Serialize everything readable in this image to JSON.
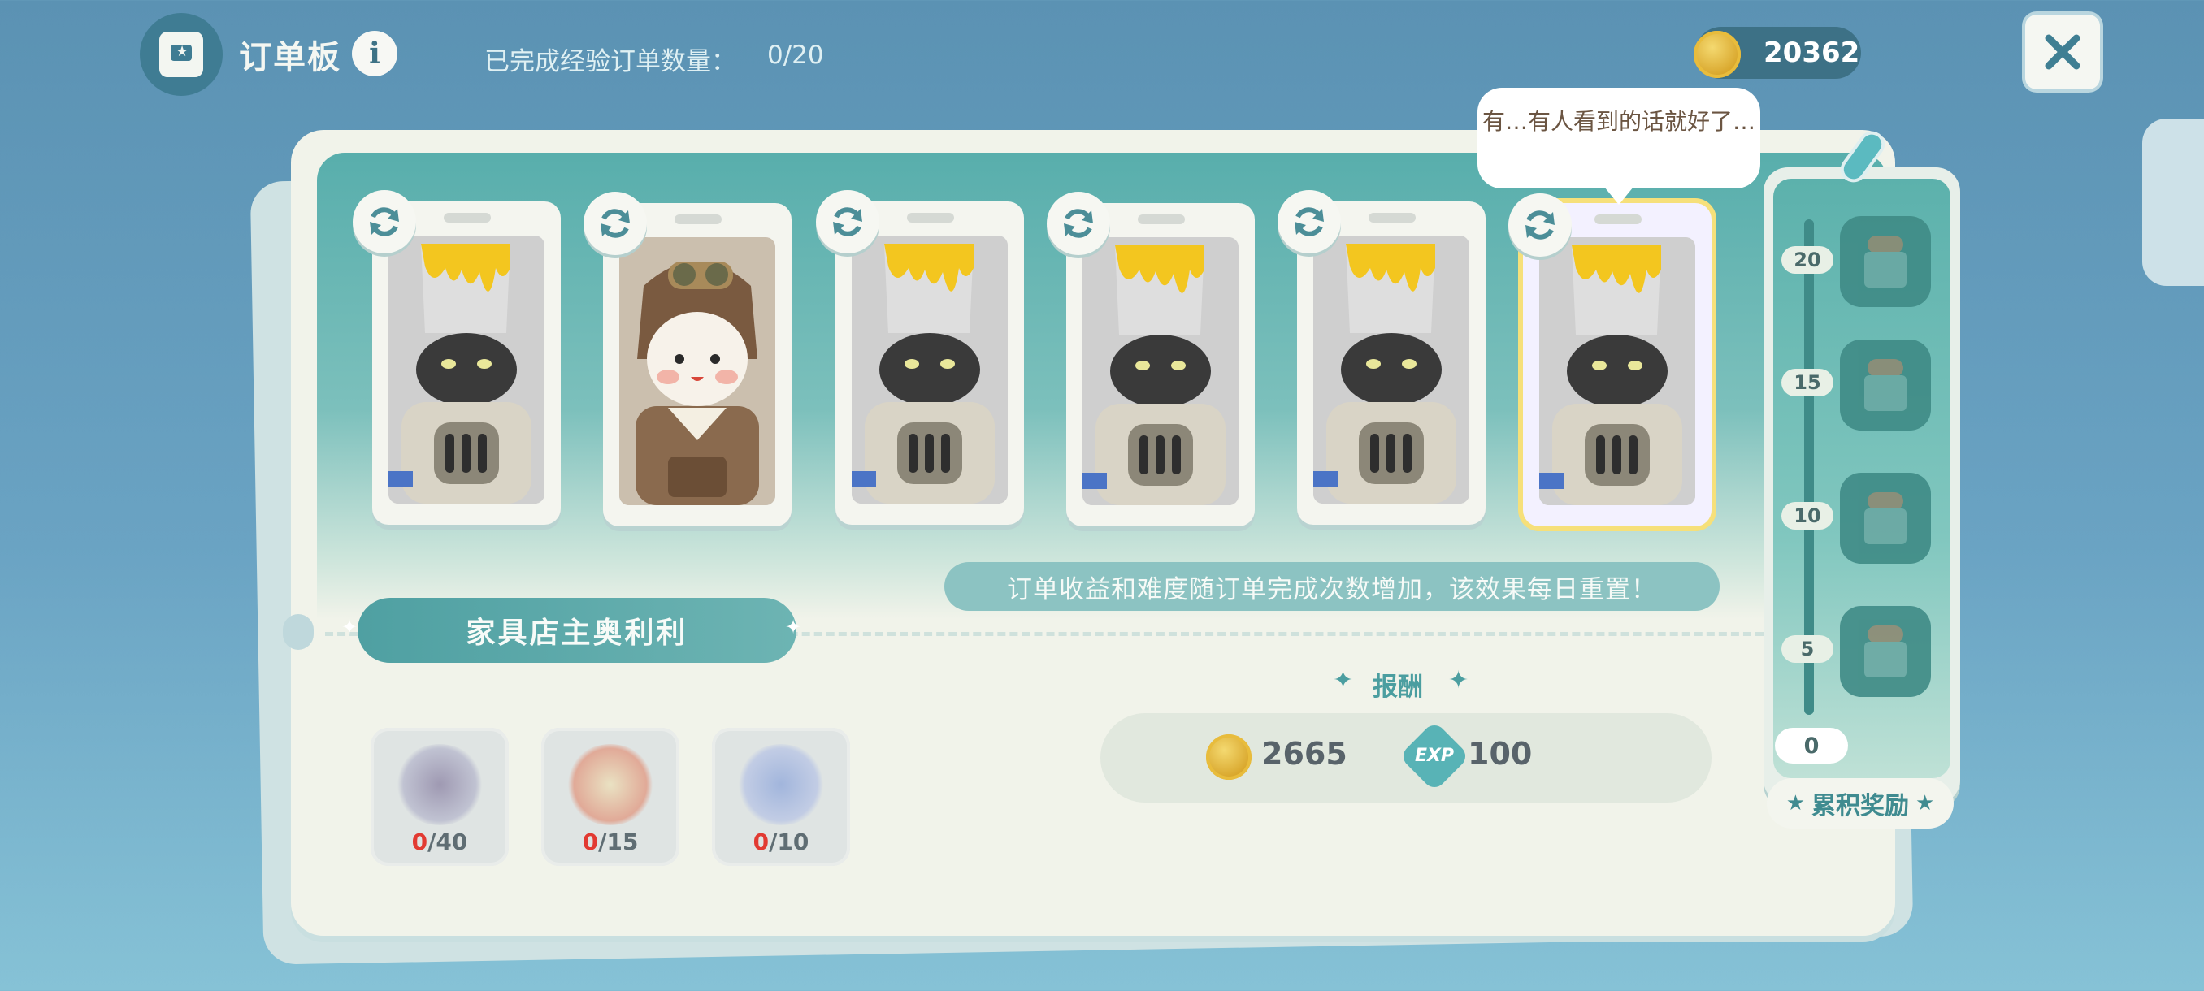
{
  "header": {
    "title": "订单板",
    "info_icon": "i",
    "progress_label": "已完成经验订单数量：",
    "progress_value": "0/20",
    "coins": "20362"
  },
  "order_cards": [
    {
      "character": "paint-bucket-robot",
      "selected": false
    },
    {
      "character": "aviator-doll",
      "selected": false
    },
    {
      "character": "paint-bucket-robot",
      "selected": false
    },
    {
      "character": "paint-bucket-robot",
      "selected": false
    },
    {
      "character": "paint-bucket-robot",
      "selected": false
    },
    {
      "character": "paint-bucket-robot",
      "selected": true
    }
  ],
  "speech_bubble": "有…有人看到的话就好了…",
  "notice": "订单收益和难度随订单完成次数增加，该效果每日重置！",
  "customer_name": "家具店主奥利利",
  "requirements": [
    {
      "item": "blueberry-tart",
      "have": "0",
      "need": "/40"
    },
    {
      "item": "tomato-slice",
      "have": "0",
      "need": "/15"
    },
    {
      "item": "blue-fish",
      "have": "0",
      "need": "/10"
    }
  ],
  "reward": {
    "title": "报酬",
    "coins": "2665",
    "exp_label": "EXP",
    "exp": "100"
  },
  "cumulative": {
    "ticks": [
      "20",
      "15",
      "10",
      "5"
    ],
    "zero": "0",
    "label": "累积奖励"
  },
  "colors": {
    "accent_teal": "#58aeac",
    "requirement_zero": "#e23a32",
    "selected_border": "#f6e07a"
  }
}
